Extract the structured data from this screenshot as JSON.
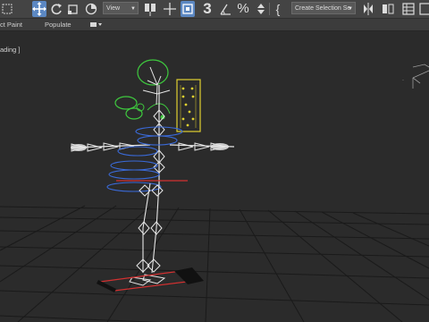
{
  "toolbar": {
    "view_dropdown": "View",
    "named_selection_placeholder": "Create Selection Se",
    "snap_3_label": "3",
    "brace_label": "{",
    "icons": [
      "selection-region-icon",
      "select-move-icon",
      "select-rotate-icon",
      "select-scale-icon",
      "percent-icon",
      "view-dropdown",
      "pivot-icon",
      "axis-constraint-icon",
      "keyboard-shortcut-icon",
      "snap-3d-icon",
      "angle-snap-icon",
      "percent-snap-icon",
      "spinner-snap-icon",
      "edit-named-selection-icon",
      "mirror-icon",
      "align-icon",
      "toggle-scene-explorer-icon",
      "layer-explorer-icon"
    ]
  },
  "ribbon": {
    "object_paint": "ct Paint",
    "populate": "Populate"
  },
  "viewport": {
    "label": "ading ]"
  },
  "colors": {
    "toolbar_bg": "#444444",
    "active_tool": "#5b87c2",
    "viewport_bg": "#2b2b2b",
    "grid": "#1c1c1c",
    "bone": "#e6e6e6",
    "helper_green": "#3ec83e",
    "helper_yellow": "#e0d130",
    "helper_blue": "#3a6ad8",
    "helper_red": "#d33030"
  }
}
